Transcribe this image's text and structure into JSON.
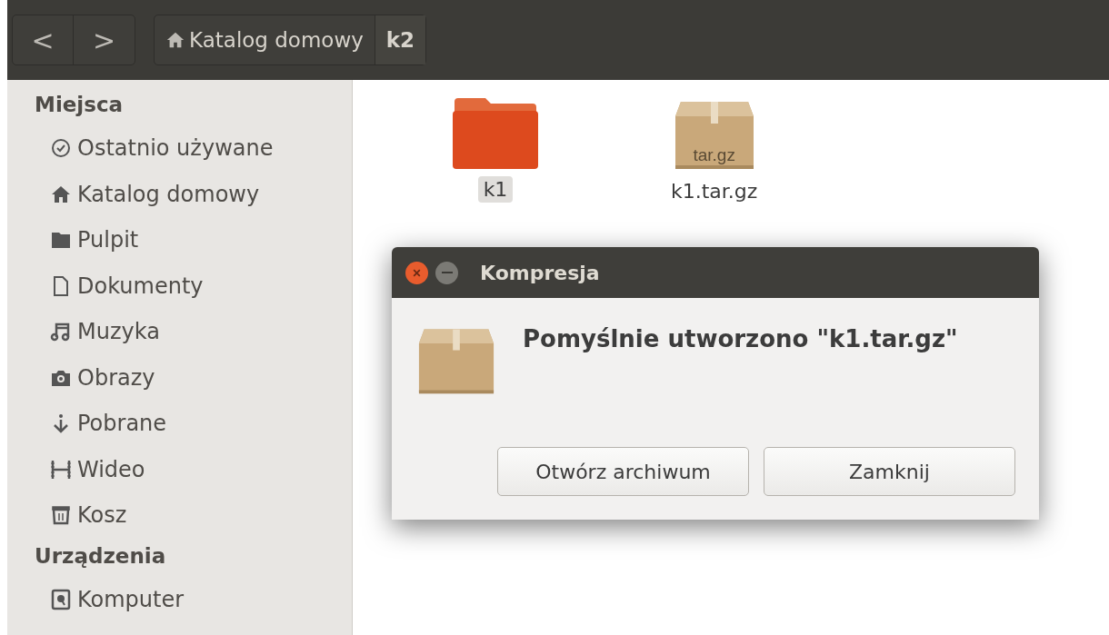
{
  "toolbar": {
    "back": "<",
    "forward": ">",
    "path": [
      {
        "label": "Katalog domowy",
        "kind": "home",
        "selected": false
      },
      {
        "label": "k2",
        "kind": "folder",
        "selected": true
      }
    ]
  },
  "sidebar": {
    "sections": [
      {
        "heading": "Miejsca",
        "items": [
          {
            "label": "Ostatnio używane"
          },
          {
            "label": "Katalog domowy"
          },
          {
            "label": "Pulpit"
          },
          {
            "label": "Dokumenty"
          },
          {
            "label": "Muzyka"
          },
          {
            "label": "Obrazy"
          },
          {
            "label": "Pobrane"
          },
          {
            "label": "Wideo"
          },
          {
            "label": "Kosz"
          }
        ]
      },
      {
        "heading": "Urządzenia",
        "items": [
          {
            "label": "Komputer"
          }
        ]
      }
    ]
  },
  "files": [
    {
      "name": "k1",
      "kind": "folder",
      "selected": true
    },
    {
      "name": "k1.tar.gz",
      "kind": "archive",
      "badge": "tar.gz",
      "selected": false
    }
  ],
  "dialog": {
    "title": "Kompresja",
    "message": "Pomyślnie utworzono \"k1.tar.gz\"",
    "buttons": [
      "Otwórz archiwum",
      "Zamknij"
    ]
  }
}
